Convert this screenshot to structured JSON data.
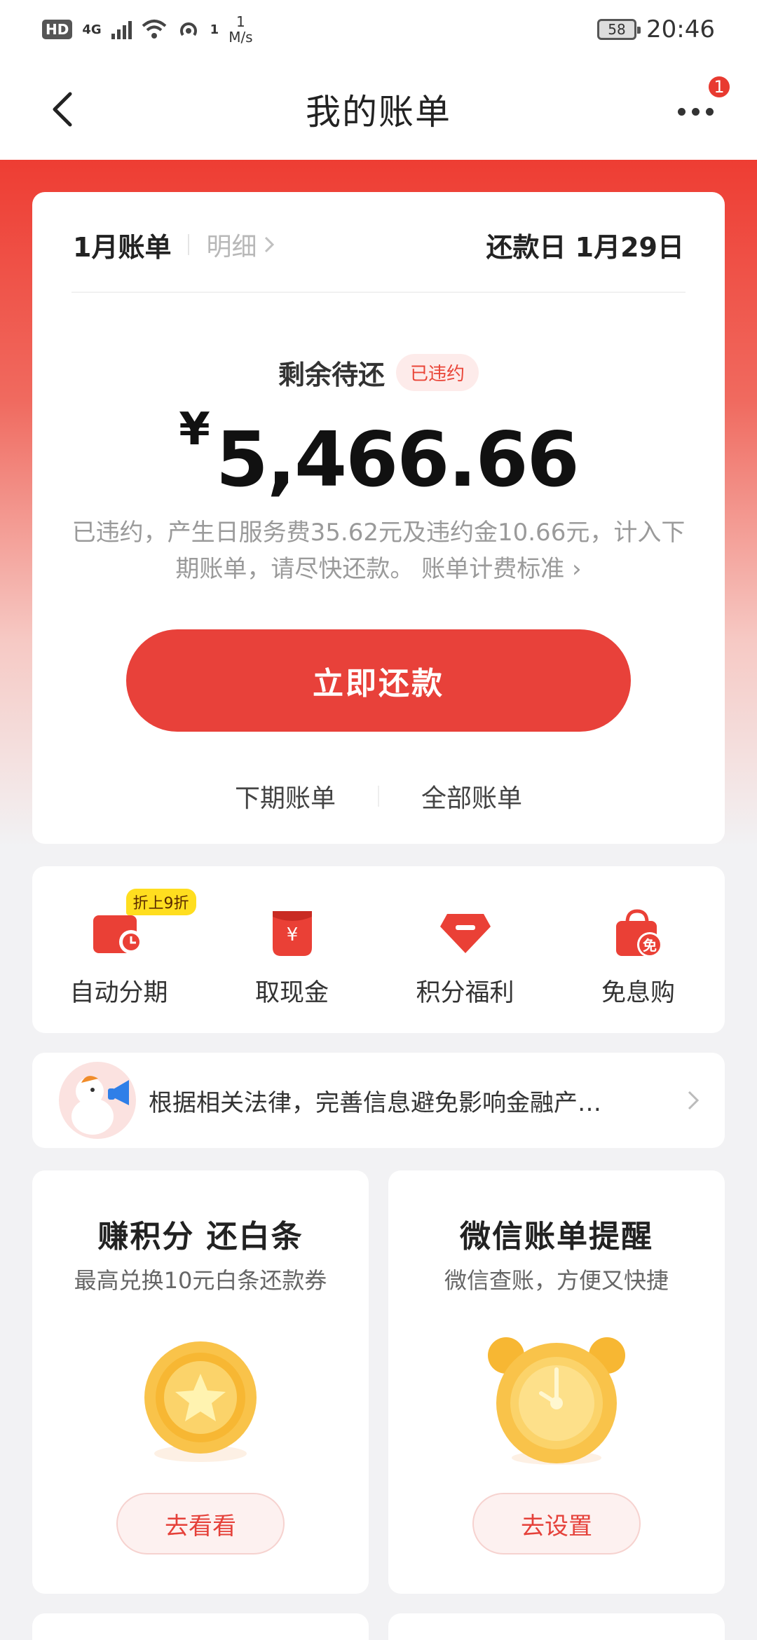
{
  "status_bar": {
    "hd": "HD",
    "network": "4G",
    "wifi_sup": "1",
    "speed_value": "1",
    "speed_unit": "M/s",
    "battery": "58",
    "time": "20:46"
  },
  "nav": {
    "title": "我的账单",
    "badge_count": "1"
  },
  "bill": {
    "month": "1月账单",
    "detail_link": "明细",
    "due_date": "还款日 1月29日",
    "remain_label": "剩余待还",
    "status_tag": "已违约",
    "currency": "¥",
    "amount": "5,466.66",
    "notice": "已违约，产生日服务费35.62元及违约金10.66元，计入下期账单，请尽快还款。",
    "notice_link": "账单计费标准",
    "pay_button": "立即还款",
    "tabs": [
      "下期账单",
      "全部账单"
    ]
  },
  "actions": [
    {
      "label": "自动分期",
      "icon": "calendar-clock-icon",
      "promo": "折上9折"
    },
    {
      "label": "取现金",
      "icon": "cash-envelope-icon"
    },
    {
      "label": "积分福利",
      "icon": "gem-icon"
    },
    {
      "label": "免息购",
      "icon": "shopping-bag-icon",
      "icon_text": "免"
    }
  ],
  "banner": {
    "text": "根据相关法律，完善信息避免影响金融产…"
  },
  "promo_cards": [
    {
      "title": "赚积分 还白条",
      "subtitle": "最高兑换10元白条还款券",
      "button": "去看看",
      "icon": "star-coin-icon"
    },
    {
      "title": "微信账单提醒",
      "subtitle": "微信查账，方便又快捷",
      "button": "去设置",
      "icon": "alarm-clock-icon"
    }
  ],
  "colors": {
    "brand_red": "#e8413a",
    "tag_bg": "#fdebea",
    "coin_gold": "#f7b733"
  }
}
